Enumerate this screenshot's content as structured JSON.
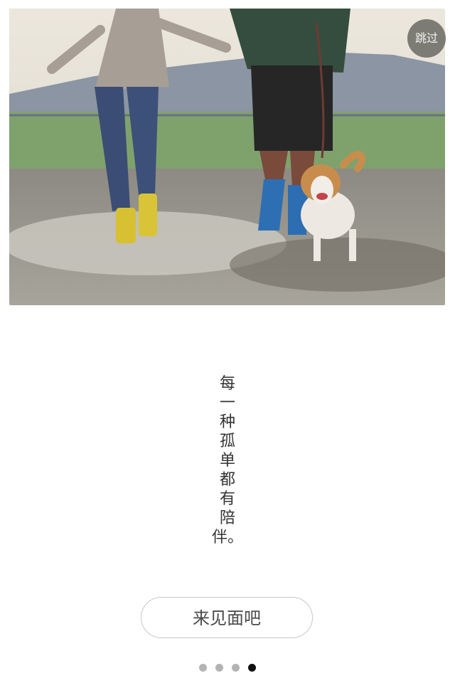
{
  "skip_label": "跳过",
  "tagline_chars": [
    "每",
    "一",
    "种",
    "孤",
    "单",
    "都",
    "有",
    "陪",
    "伴。"
  ],
  "cta_label": "来见面吧",
  "pager": {
    "count": 4,
    "active_index": 3
  },
  "colors": {
    "skip_bg": "#696862",
    "dot_inactive": "#b3b3b3",
    "dot_active": "#111111",
    "button_border": "#c7c7c7"
  }
}
